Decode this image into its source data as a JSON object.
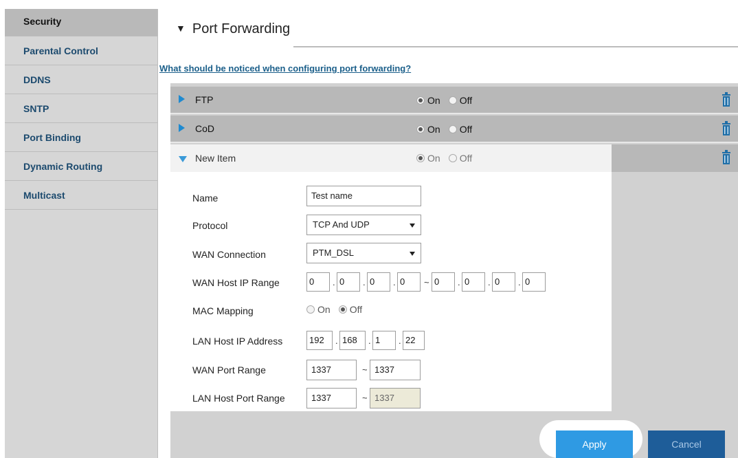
{
  "sidebar": {
    "items": [
      {
        "label": "Security"
      },
      {
        "label": "Parental Control"
      },
      {
        "label": "DDNS"
      },
      {
        "label": "SNTP"
      },
      {
        "label": "Port Binding"
      },
      {
        "label": "Dynamic Routing"
      },
      {
        "label": "Multicast"
      }
    ]
  },
  "header": {
    "title": "Port Forwarding",
    "help_link": "What should be noticed when configuring port forwarding?"
  },
  "rules": [
    {
      "name": "FTP",
      "on_label": "On",
      "off_label": "Off",
      "state": "on"
    },
    {
      "name": "CoD",
      "on_label": "On",
      "off_label": "Off",
      "state": "on"
    }
  ],
  "new_item": {
    "name": "New Item",
    "on_label": "On",
    "off_label": "Off",
    "state": "on",
    "form": {
      "name_label": "Name",
      "name_value": "Test name",
      "protocol_label": "Protocol",
      "protocol_value": "TCP And UDP",
      "wan_connection_label": "WAN Connection",
      "wan_connection_value": "PTM_DSL",
      "wan_host_ip_range_label": "WAN Host IP Range",
      "wan_ip_start": [
        "0",
        "0",
        "0",
        "0"
      ],
      "wan_ip_end": [
        "0",
        "0",
        "0",
        "0"
      ],
      "mac_mapping_label": "MAC Mapping",
      "mac_on_label": "On",
      "mac_off_label": "Off",
      "mac_state": "off",
      "lan_host_ip_label": "LAN Host IP Address",
      "lan_ip": [
        "192",
        "168",
        "1",
        "22"
      ],
      "wan_port_range_label": "WAN Port Range",
      "wan_port_start": "1337",
      "wan_port_end": "1337",
      "lan_host_port_range_label": "LAN Host Port Range",
      "lan_port_start": "1337",
      "lan_port_end": "1337",
      "range_sep": "~",
      "dot": "."
    }
  },
  "buttons": {
    "apply": "Apply",
    "cancel": "Cancel"
  },
  "colors": {
    "accent": "#2f9ae3",
    "link": "#1b5f8a",
    "sidebar_text": "#1c4a6e"
  }
}
